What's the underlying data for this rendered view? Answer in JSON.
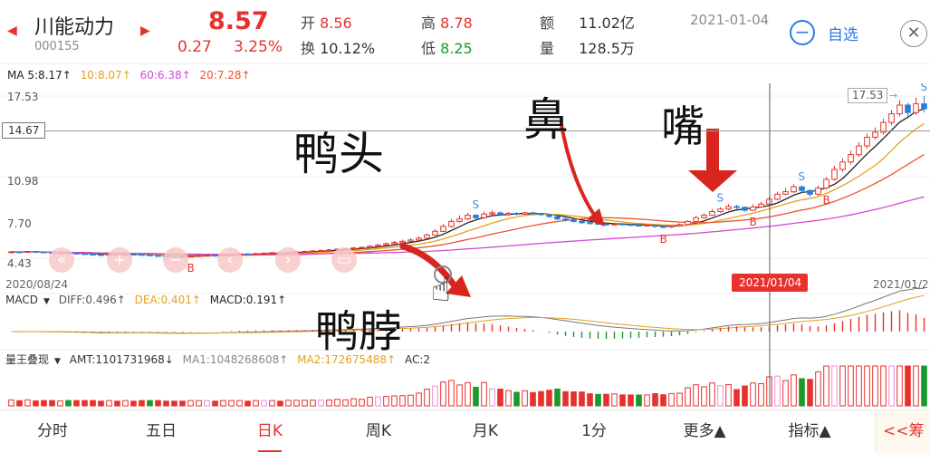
{
  "header": {
    "stock_name": "川能动力",
    "stock_code": "000155",
    "price": "8.57",
    "change": "0.27",
    "change_pct": "3.25%",
    "open_label": "开",
    "open_value": "8.56",
    "turnover_label": "换",
    "turnover_value": "10.12%",
    "high_label": "高",
    "high_value": "8.78",
    "low_label": "低",
    "low_value": "8.25",
    "amount_label": "额",
    "amount_value": "11.02亿",
    "volume_label": "量",
    "volume_value": "128.5万",
    "date": "2021-01-04",
    "watchlist_label": "自选"
  },
  "ma_legend": {
    "ma5": "MA 5:8.17↑",
    "ma10": "10:8.07↑",
    "ma60": "60:6.38↑",
    "ma20": "20:7.28↑"
  },
  "price_axis": {
    "top": "17.53",
    "mid": "14.67",
    "l3": "10.98",
    "l4": "7.70",
    "bottom": "4.43",
    "right_top": "17.53"
  },
  "dates": {
    "left": "2020/08/24",
    "cursor": "2021/01/04",
    "right": "2021/01/2"
  },
  "signals": {
    "buy": "B",
    "sell": "S"
  },
  "macd_legend": {
    "name": "MACD",
    "diff": "DIFF:0.496↑",
    "dea": "DEA:0.401↑",
    "macd": "MACD:0.191↑"
  },
  "vol_legend": {
    "name": "量王叠现",
    "amt": "AMT:1101731968↓",
    "ma1": "MA1:1048268608↑",
    "ma2": "MA2:172675488↑",
    "ac": "AC:2"
  },
  "annotations": {
    "duck_head": "鸭头",
    "nose": "鼻",
    "mouth": "嘴",
    "duck_neck": "鸭脖"
  },
  "tabs": [
    "分时",
    "五日",
    "日K",
    "周K",
    "月K",
    "1分",
    "更多▲",
    "指标▲",
    "<<筹"
  ],
  "active_tab": 2,
  "chart_data": {
    "type": "candlestick",
    "ylim": [
      4.43,
      17.53
    ],
    "candles": [
      [
        4.9,
        4.95,
        5.0,
        4.85
      ],
      [
        4.95,
        4.92,
        5.0,
        4.88
      ],
      [
        4.92,
        4.98,
        5.02,
        4.88
      ],
      [
        4.98,
        4.94,
        5.0,
        4.9
      ],
      [
        4.94,
        4.9,
        4.98,
        4.86
      ],
      [
        4.9,
        4.86,
        4.94,
        4.82
      ],
      [
        4.86,
        4.88,
        4.92,
        4.8
      ],
      [
        4.88,
        4.84,
        4.92,
        4.8
      ],
      [
        4.84,
        4.8,
        4.88,
        4.76
      ],
      [
        4.8,
        4.76,
        4.84,
        4.72
      ],
      [
        4.76,
        4.72,
        4.8,
        4.68
      ],
      [
        4.72,
        4.7,
        4.76,
        4.66
      ],
      [
        4.7,
        4.74,
        4.78,
        4.66
      ],
      [
        4.74,
        4.72,
        4.78,
        4.68
      ],
      [
        4.72,
        4.76,
        4.8,
        4.68
      ],
      [
        4.76,
        4.74,
        4.8,
        4.7
      ],
      [
        4.74,
        4.7,
        4.78,
        4.66
      ],
      [
        4.7,
        4.66,
        4.74,
        4.62
      ],
      [
        4.66,
        4.62,
        4.7,
        4.58
      ],
      [
        4.62,
        4.6,
        4.66,
        4.56
      ],
      [
        4.6,
        4.58,
        4.64,
        4.54
      ],
      [
        4.58,
        4.56,
        4.62,
        4.52
      ],
      [
        4.56,
        4.6,
        4.64,
        4.52
      ],
      [
        4.6,
        4.64,
        4.68,
        4.56
      ],
      [
        4.64,
        4.68,
        4.72,
        4.6
      ],
      [
        4.68,
        4.66,
        4.72,
        4.62
      ],
      [
        4.66,
        4.7,
        4.74,
        4.62
      ],
      [
        4.7,
        4.74,
        4.78,
        4.66
      ],
      [
        4.74,
        4.78,
        4.82,
        4.7
      ],
      [
        4.78,
        4.76,
        4.82,
        4.72
      ],
      [
        4.76,
        4.8,
        4.84,
        4.72
      ],
      [
        4.8,
        4.84,
        4.88,
        4.76
      ],
      [
        4.84,
        4.88,
        4.92,
        4.8
      ],
      [
        4.88,
        4.86,
        4.92,
        4.82
      ],
      [
        4.86,
        4.9,
        4.96,
        4.82
      ],
      [
        4.9,
        4.94,
        5.0,
        4.86
      ],
      [
        4.94,
        4.98,
        5.04,
        4.9
      ],
      [
        4.98,
        5.02,
        5.08,
        4.94
      ],
      [
        5.02,
        5.06,
        5.12,
        4.98
      ],
      [
        5.06,
        5.1,
        5.16,
        5.02
      ],
      [
        5.1,
        5.16,
        5.22,
        5.06
      ],
      [
        5.16,
        5.2,
        5.26,
        5.12
      ],
      [
        5.2,
        5.26,
        5.34,
        5.16
      ],
      [
        5.26,
        5.3,
        5.38,
        5.22
      ],
      [
        5.3,
        5.4,
        5.48,
        5.26
      ],
      [
        5.4,
        5.5,
        5.58,
        5.36
      ],
      [
        5.5,
        5.6,
        5.7,
        5.46
      ],
      [
        5.6,
        5.7,
        5.82,
        5.56
      ],
      [
        5.7,
        5.8,
        5.92,
        5.66
      ],
      [
        5.8,
        5.9,
        6.04,
        5.76
      ],
      [
        5.9,
        6.05,
        6.2,
        5.86
      ],
      [
        6.05,
        6.3,
        6.45,
        6.0
      ],
      [
        6.3,
        6.6,
        6.8,
        6.25
      ],
      [
        6.6,
        7.0,
        7.2,
        6.55
      ],
      [
        7.0,
        7.4,
        7.6,
        6.9
      ],
      [
        7.4,
        7.6,
        7.9,
        7.3
      ],
      [
        7.6,
        7.9,
        8.1,
        7.5
      ],
      [
        7.9,
        7.7,
        8.0,
        7.55
      ],
      [
        7.7,
        8.0,
        8.2,
        7.6
      ],
      [
        8.0,
        8.1,
        8.3,
        7.9
      ],
      [
        8.1,
        7.95,
        8.2,
        7.85
      ],
      [
        7.95,
        8.05,
        8.15,
        7.85
      ],
      [
        8.05,
        8.0,
        8.15,
        7.9
      ],
      [
        8.0,
        8.1,
        8.2,
        7.92
      ],
      [
        8.1,
        8.05,
        8.18,
        7.95
      ],
      [
        8.05,
        7.95,
        8.1,
        7.85
      ],
      [
        7.95,
        7.8,
        8.0,
        7.7
      ],
      [
        7.8,
        7.6,
        7.85,
        7.5
      ],
      [
        7.6,
        7.5,
        7.7,
        7.4
      ],
      [
        7.5,
        7.4,
        7.6,
        7.3
      ],
      [
        7.4,
        7.3,
        7.5,
        7.2
      ],
      [
        7.3,
        7.25,
        7.4,
        7.15
      ],
      [
        7.25,
        7.2,
        7.32,
        7.1
      ],
      [
        7.2,
        7.15,
        7.28,
        7.05
      ],
      [
        7.15,
        7.2,
        7.3,
        7.05
      ],
      [
        7.2,
        7.15,
        7.28,
        7.08
      ],
      [
        7.15,
        7.1,
        7.22,
        7.02
      ],
      [
        7.1,
        7.05,
        7.18,
        6.98
      ],
      [
        7.05,
        7.1,
        7.18,
        6.98
      ],
      [
        7.1,
        7.0,
        7.14,
        6.9
      ],
      [
        7.0,
        6.95,
        7.08,
        6.85
      ],
      [
        6.95,
        7.05,
        7.12,
        6.88
      ],
      [
        7.05,
        7.15,
        7.25,
        7.0
      ],
      [
        7.15,
        7.4,
        7.5,
        7.1
      ],
      [
        7.4,
        7.7,
        7.85,
        7.35
      ],
      [
        7.7,
        7.9,
        8.05,
        7.6
      ],
      [
        7.9,
        8.2,
        8.4,
        7.85
      ],
      [
        8.2,
        8.4,
        8.55,
        8.1
      ],
      [
        8.4,
        8.6,
        8.8,
        8.3
      ],
      [
        8.6,
        8.55,
        8.75,
        8.4
      ],
      [
        8.55,
        8.3,
        8.6,
        8.2
      ],
      [
        8.3,
        8.57,
        8.78,
        8.25
      ],
      [
        8.57,
        8.8,
        9.0,
        8.5
      ],
      [
        8.8,
        9.2,
        9.4,
        8.7
      ],
      [
        9.2,
        9.6,
        9.8,
        9.1
      ],
      [
        9.6,
        9.8,
        10.1,
        9.5
      ],
      [
        9.8,
        10.2,
        10.4,
        9.7
      ],
      [
        10.2,
        9.9,
        10.3,
        9.7
      ],
      [
        9.9,
        9.6,
        10.0,
        9.4
      ],
      [
        9.6,
        10.1,
        10.3,
        9.5
      ],
      [
        10.1,
        10.8,
        11.0,
        10.0
      ],
      [
        10.8,
        11.6,
        11.9,
        10.7
      ],
      [
        11.6,
        12.2,
        12.5,
        11.4
      ],
      [
        12.2,
        12.8,
        13.1,
        12.0
      ],
      [
        12.8,
        13.5,
        13.8,
        12.6
      ],
      [
        13.5,
        14.2,
        14.5,
        13.3
      ],
      [
        14.2,
        14.6,
        15.0,
        14.0
      ],
      [
        14.6,
        15.4,
        15.7,
        14.4
      ],
      [
        15.4,
        16.1,
        16.4,
        15.2
      ],
      [
        16.1,
        16.8,
        17.2,
        15.9
      ],
      [
        16.8,
        16.2,
        17.0,
        15.9
      ],
      [
        16.2,
        16.9,
        17.4,
        16.0
      ],
      [
        16.9,
        16.5,
        17.53,
        16.2
      ]
    ],
    "signals": [
      {
        "i": 22,
        "type": "B"
      },
      {
        "i": 57,
        "type": "S"
      },
      {
        "i": 80,
        "type": "B"
      },
      {
        "i": 87,
        "type": "S"
      },
      {
        "i": 91,
        "type": "B"
      },
      {
        "i": 97,
        "type": "S"
      },
      {
        "i": 100,
        "type": "B"
      },
      {
        "i": 112,
        "type": "S"
      }
    ]
  }
}
